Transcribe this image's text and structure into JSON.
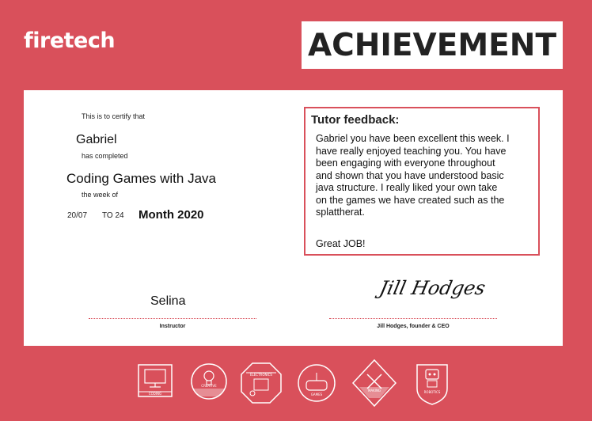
{
  "header": {
    "logo": "firetech",
    "title": "ACHIEVEMENT"
  },
  "certificate": {
    "certify_text": "This is to certify that",
    "student_name": "Gabriel",
    "completed_text": "has completed",
    "course_name": "Coding Games with Java",
    "week_of_text": "the week of",
    "date_from": "20/07",
    "date_to": "TO 24",
    "month_year": "Month 2020"
  },
  "feedback": {
    "title": "Tutor feedback:",
    "lines": [
      "Gabriel you have been excellent this week. I",
      "have really enjoyed teaching you. You have",
      "been engaging with everyone throughout",
      "and shown that you have understood basic",
      "java structure. I really liked your own take",
      "on the games we have created such as the",
      "splattherat."
    ],
    "sign_off": "Great JOB!"
  },
  "signatures": {
    "instructor_name": "Selina",
    "instructor_caption": "Instructor",
    "founder_signature": "Jill Hodges",
    "founder_caption": "Jill Hodges, founder & CEO"
  },
  "badges": [
    {
      "label": "CODING",
      "icon": "monitor-icon"
    },
    {
      "label": "CREATIVE",
      "icon": "lightbulb-icon"
    },
    {
      "label": "ELECTRONICS",
      "icon": "circuit-icon"
    },
    {
      "label": "GAMES",
      "icon": "gamepad-icon"
    },
    {
      "label": "MAKING",
      "icon": "tools-icon"
    },
    {
      "label": "ROBOTICS",
      "icon": "robot-icon"
    }
  ],
  "colors": {
    "brand_red": "#d9505b",
    "text_dark": "#222222"
  }
}
